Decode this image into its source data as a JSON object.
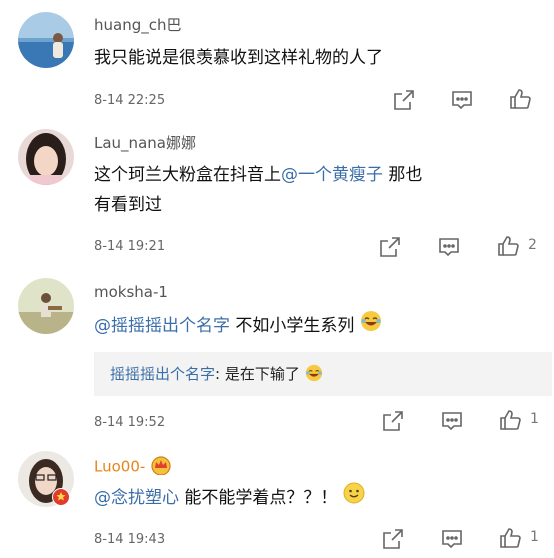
{
  "comments": [
    {
      "username": "huang_ch巴",
      "text": "我只能说是很羡慕收到这样礼物的人了",
      "time": "8-14 22:25",
      "likes": ""
    },
    {
      "username": "Lau_nana娜娜",
      "text_before": "这个珂兰大粉盒在抖音上",
      "mention": "@一个黄瘦子",
      "text_after": " 那也",
      "text_line2": "有看到过",
      "time": "8-14 19:21",
      "likes": "2"
    },
    {
      "username": "moksha-1",
      "mention": "@摇摇摇出个名字",
      "text": " 不如小学生系列",
      "reply_author": "摇摇摇出个名字",
      "reply_text": ": 是在下输了",
      "time": "8-14 19:52",
      "likes": "1"
    },
    {
      "username": "Luo00-",
      "mention": "@念扰塑心",
      "text": " 能不能学着点？？！",
      "time": "8-14 19:43",
      "likes": "1"
    }
  ],
  "colors": {
    "mention": "#3b6ea8",
    "username": "#555555",
    "orange_username": "#e8851a",
    "meta": "#666666",
    "reply_bg": "#f3f3f3"
  },
  "icons": [
    "share-icon",
    "comment-icon",
    "thumbs-up-icon",
    "laughing-emoji-icon",
    "smile-emoji-icon",
    "crown-badge-icon",
    "verified-badge-icon"
  ]
}
